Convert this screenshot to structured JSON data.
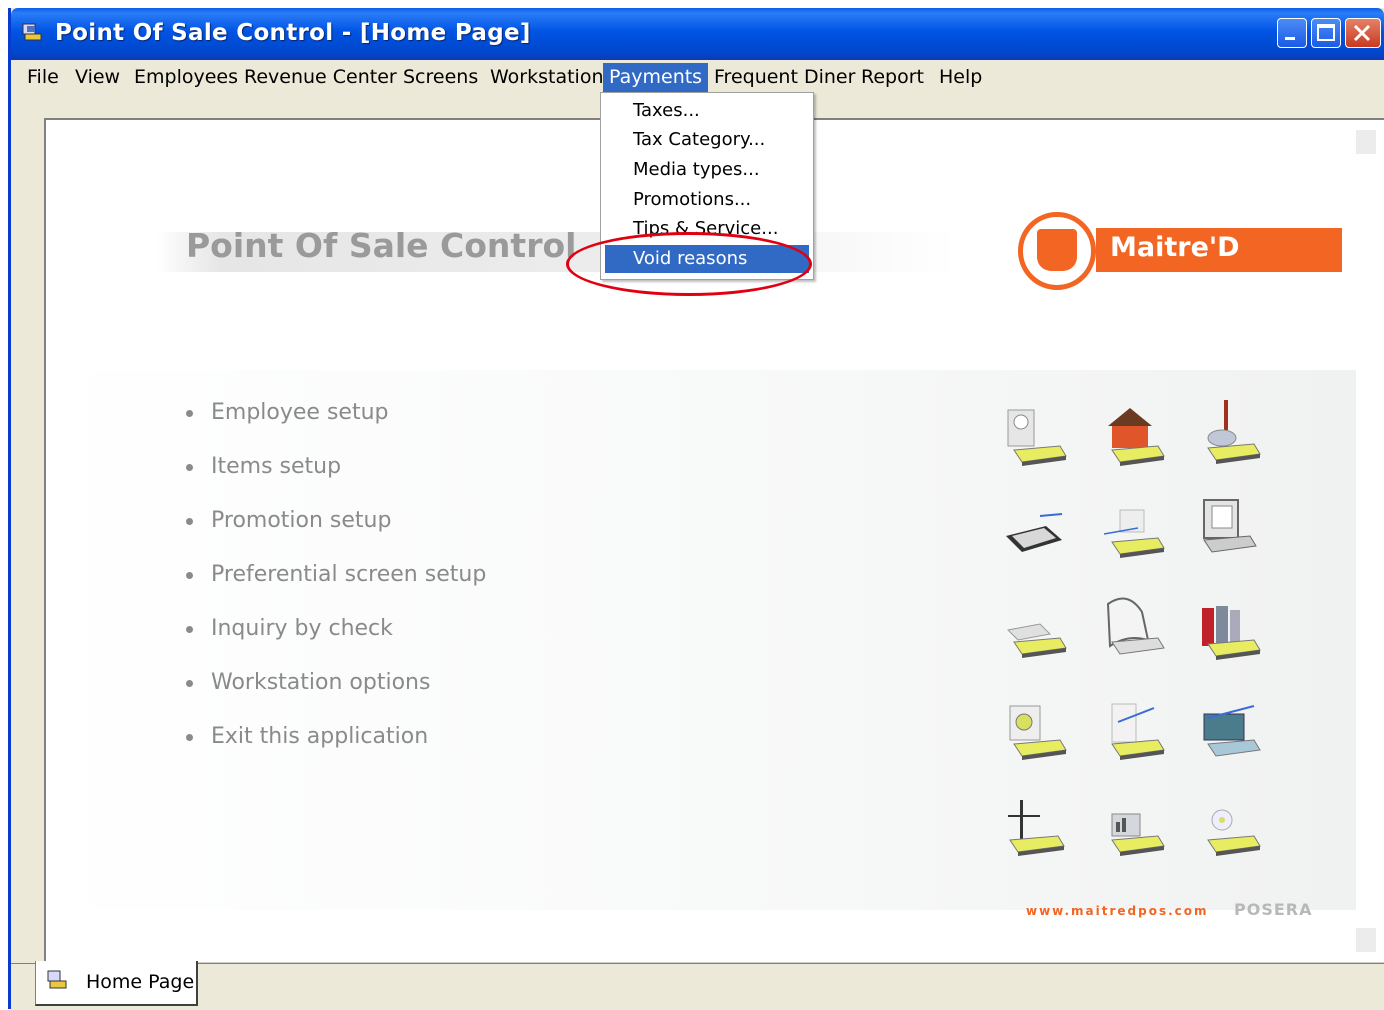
{
  "window": {
    "title": "Point Of Sale Control - [Home Page]"
  },
  "menubar": {
    "items": [
      {
        "label": "File"
      },
      {
        "label": "View"
      },
      {
        "label": "Employees"
      },
      {
        "label": "Revenue Center"
      },
      {
        "label": "Screens"
      },
      {
        "label": "Workstation"
      },
      {
        "label": "Payments"
      },
      {
        "label": "Frequent Diner"
      },
      {
        "label": "Report"
      },
      {
        "label": "Help"
      }
    ],
    "active": "Payments"
  },
  "payments_menu": {
    "items": [
      {
        "label": "Taxes..."
      },
      {
        "label": "Tax Category..."
      },
      {
        "label": "Media types..."
      },
      {
        "label": "Promotions..."
      },
      {
        "label": "Tips & Service..."
      },
      {
        "label": "Void reasons"
      }
    ],
    "selected": "Void reasons"
  },
  "home": {
    "heading": "Point Of Sale Control",
    "brand": "Maitre'D",
    "links": [
      {
        "label": "Employee setup"
      },
      {
        "label": "Items setup"
      },
      {
        "label": "Promotion setup"
      },
      {
        "label": "Preferential screen setup"
      },
      {
        "label": "Inquiry by check"
      },
      {
        "label": "Workstation options"
      },
      {
        "label": "Exit this application"
      }
    ],
    "website": "www.maitredpos.com",
    "footer_brand": "POSERA"
  },
  "tabs": [
    {
      "label": "Home Page"
    }
  ],
  "colors": {
    "brand_orange": "#f26522",
    "selection_blue": "#316ac5",
    "xp_title_blue": "#0054e3",
    "highlight_red": "#e00010"
  },
  "icons": {
    "grid": [
      "cd-reader-icon",
      "house-icon",
      "flask-icon",
      "laptop-icon",
      "document-icon",
      "computer-icon",
      "paper-stack-icon",
      "printer-icon",
      "books-icon",
      "disk-icon",
      "network-icon",
      "server-icon",
      "crane-icon",
      "chart-icon",
      "cd-icon"
    ]
  }
}
